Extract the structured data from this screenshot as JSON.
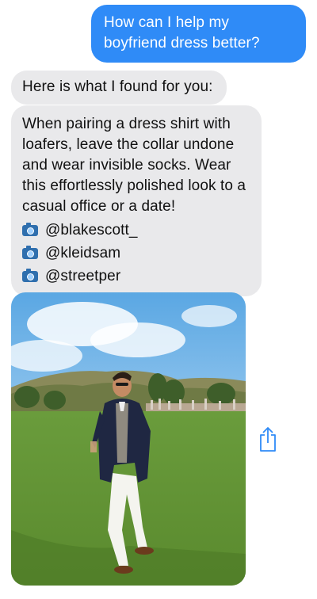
{
  "conversation": {
    "user_message": "How can I help my boyfriend dress better?",
    "bot_intro": "Here is what I found for you:",
    "bot_tip": "When pairing a dress shirt with loafers, leave the collar undone and wear invisible socks. Wear this effortlessly polished look to a casual office or a date!",
    "credits": [
      "@blakescott_",
      "@kleidsam",
      "@streetper"
    ]
  },
  "icons": {
    "credit": "camera-icon",
    "share": "share-icon"
  },
  "colors": {
    "outgoing_bubble": "#2f8bf7",
    "incoming_bubble": "#e9e9eb",
    "share_icon": "#2f8bf7"
  }
}
